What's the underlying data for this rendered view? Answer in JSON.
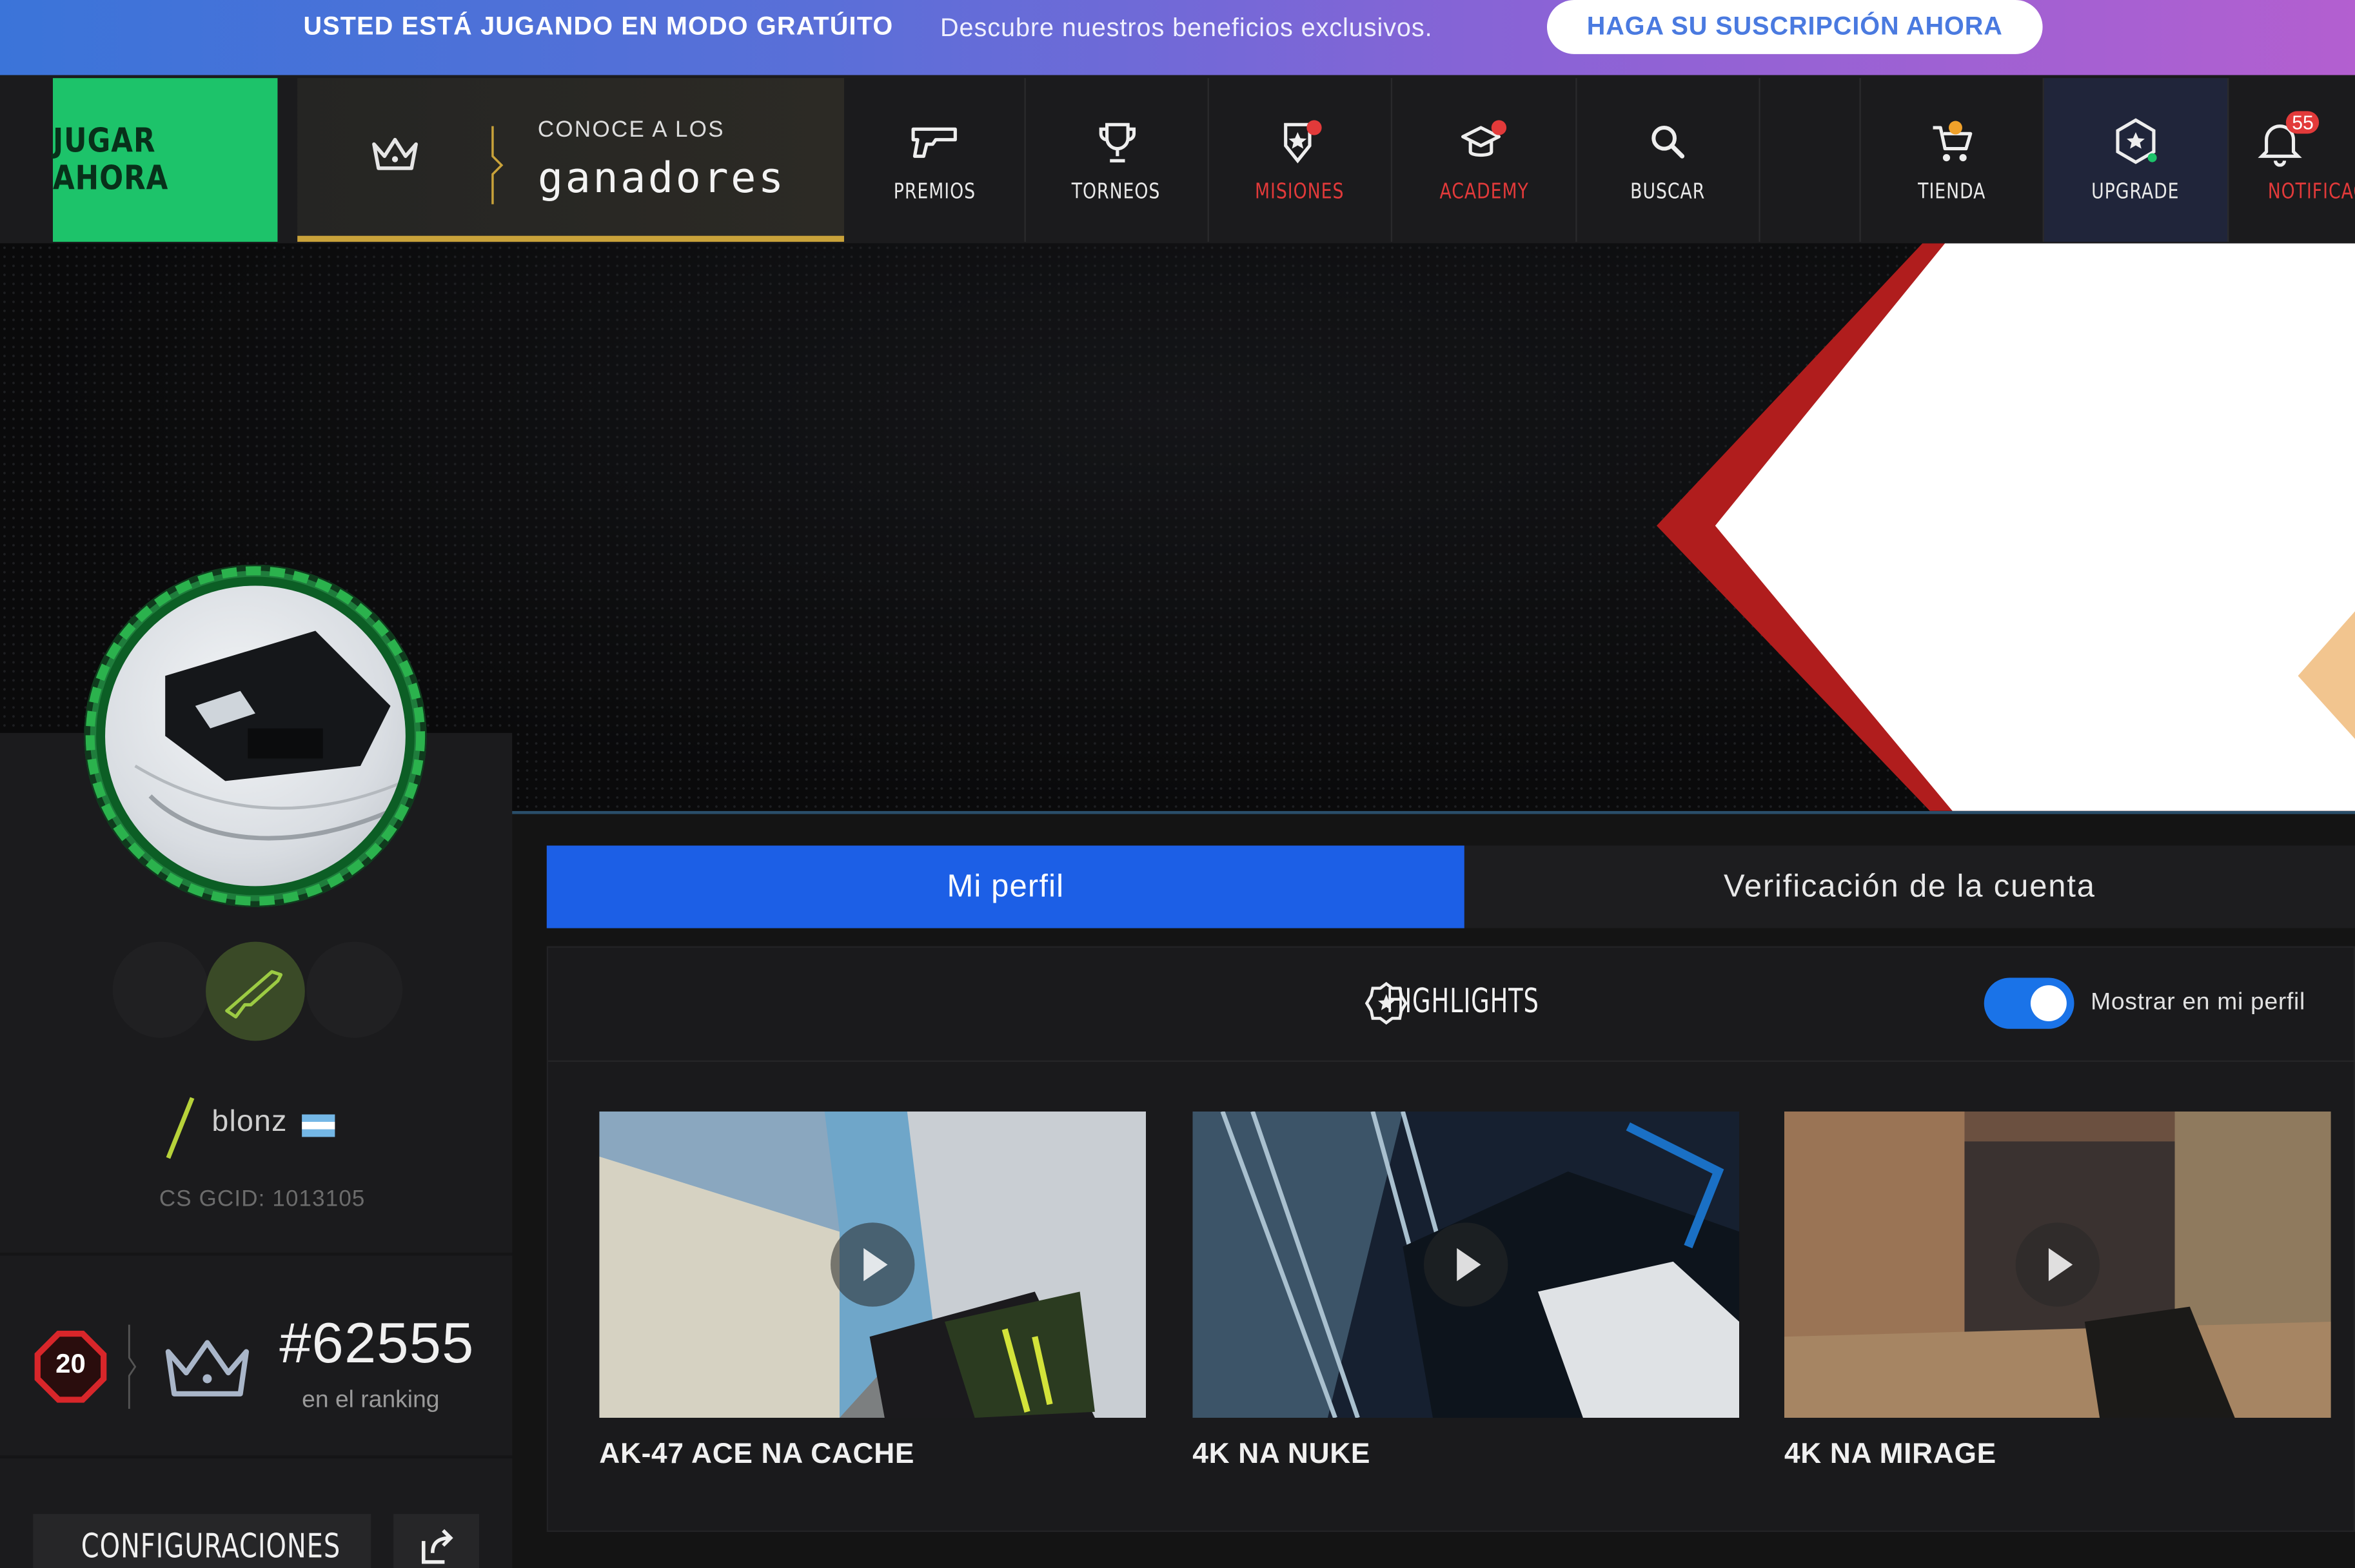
{
  "banner": {
    "free_mode": "USTED ESTÁ JUGANDO EN MODO GRATÚITO",
    "description": "Descubre nuestros beneficios exclusivos.",
    "cta": "HAGA SU SUSCRIPCIÓN AHORA"
  },
  "nav": {
    "play_now": "JUGAR AHORA",
    "winners_line1": "CONOCE A LOS",
    "winners_line2": "ganadores",
    "items": [
      {
        "label": "PREMIOS",
        "icon": "pistol-icon"
      },
      {
        "label": "TORNEOS",
        "icon": "trophy-icon"
      },
      {
        "label": "MISIONES",
        "icon": "mission-badge-icon"
      },
      {
        "label": "ACADEMY",
        "icon": "graduation-cap-icon"
      },
      {
        "label": "BUSCAR",
        "icon": "search-icon"
      },
      {
        "label": "TIENDA",
        "icon": "cart-icon"
      },
      {
        "label": "UPGRADE",
        "icon": "upgrade-star-icon"
      },
      {
        "label": "NOTIFICAÇÕES",
        "icon": "bell-icon"
      }
    ],
    "notifications_count": "55"
  },
  "profile": {
    "nickname": "blonz",
    "gcid": "CS GCID: 1013105",
    "level": "20",
    "rank": "#62555",
    "rank_label": "en el ranking",
    "settings_button": "CONFIGURACIONES"
  },
  "tabs": {
    "my_profile": "Mi perfil",
    "verification": "Verificación de la cuenta"
  },
  "highlights": {
    "title": "HIGHLIGHTS",
    "toggle_label": "Mostrar en mi perfil",
    "toggle_on": true,
    "clips": [
      {
        "title": "AK-47 ACE NA CACHE"
      },
      {
        "title": "4K NA NUKE"
      },
      {
        "title": "4K NA MIRAGE"
      }
    ]
  },
  "colors": {
    "accent_blue": "#1c5fe6",
    "play_green": "#1dc36a",
    "gold": "#c9a23a",
    "red": "#e23a3a"
  }
}
